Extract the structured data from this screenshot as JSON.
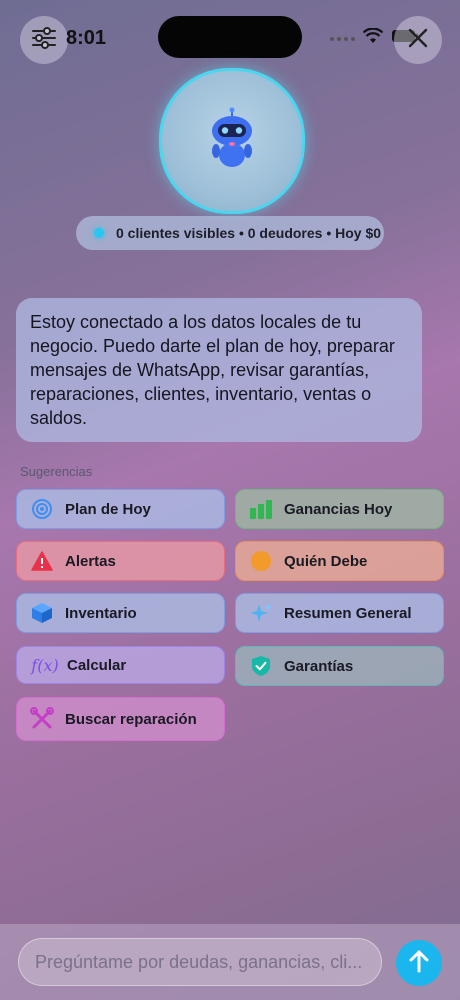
{
  "status": {
    "time": "8:01"
  },
  "summary": {
    "text": "0 clientes visibles • 0 deudores • Hoy $0"
  },
  "message": {
    "text": "Estoy conectado a los datos locales de tu negocio. Puedo darte el plan de hoy, preparar mensajes de WhatsApp, revisar garantías, reparaciones, clientes, inventario, ventas o saldos."
  },
  "suggestions": {
    "title": "Sugerencias",
    "items": [
      {
        "label": "Plan de Hoy",
        "icon": "target-icon"
      },
      {
        "label": "Ganancias Hoy",
        "icon": "bar-chart-icon"
      },
      {
        "label": "Alertas",
        "icon": "warning-icon"
      },
      {
        "label": "Quién Debe",
        "icon": "coin-icon"
      },
      {
        "label": "Inventario",
        "icon": "box-icon"
      },
      {
        "label": "Resumen General",
        "icon": "sparkle-icon"
      },
      {
        "label": "Calcular",
        "icon": "function-icon"
      },
      {
        "label": "Garantías",
        "icon": "shield-check-icon"
      },
      {
        "label": "Buscar reparación",
        "icon": "tools-icon"
      }
    ]
  },
  "composer": {
    "placeholder": "Pregúntame por deudas, ganancias, cli..."
  },
  "colors": {
    "accent": "#1cb6ee",
    "ring": "#4ad6ee"
  }
}
